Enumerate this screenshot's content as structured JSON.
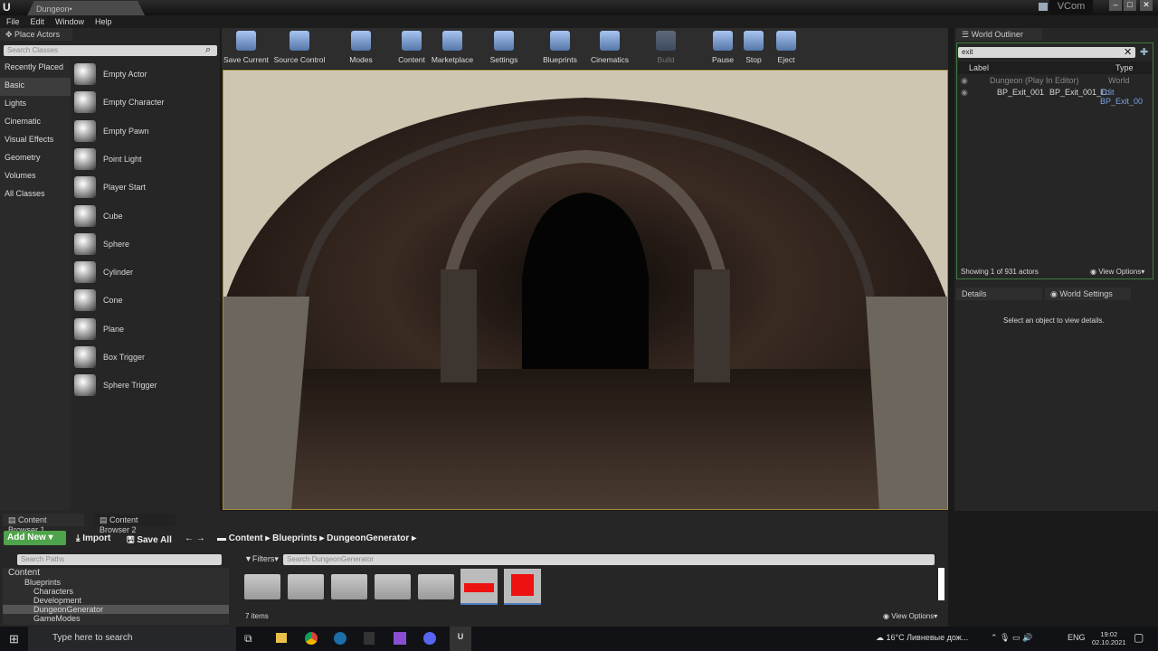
{
  "window": {
    "doc_tab": "Dungeon•",
    "user": "VCom",
    "logo": "U"
  },
  "menu": [
    "File",
    "Edit",
    "Window",
    "Help"
  ],
  "place_actors": {
    "tab": "Place Actors",
    "search_placeholder": "Search Classes",
    "categories": [
      "Recently Placed",
      "Basic",
      "Lights",
      "Cinematic",
      "Visual Effects",
      "Geometry",
      "Volumes",
      "All Classes"
    ],
    "selected_category": "Basic",
    "items": [
      "Empty Actor",
      "Empty Character",
      "Empty Pawn",
      "Point Light",
      "Player Start",
      "Cube",
      "Sphere",
      "Cylinder",
      "Cone",
      "Plane",
      "Box Trigger",
      "Sphere Trigger"
    ]
  },
  "toolbar": [
    "Save Current",
    "Source Control",
    "Modes",
    "Content",
    "Marketplace",
    "Settings",
    "Blueprints",
    "Cinematics",
    "Build",
    "Pause",
    "Stop",
    "Eject"
  ],
  "outliner": {
    "tab": "World Outliner",
    "search_value": "exit",
    "col_label": "Label",
    "col_type": "Type",
    "rows": [
      {
        "label": "Dungeon (Play In Editor)",
        "type": "World",
        "extra": ""
      },
      {
        "label": "BP_Exit_001",
        "type": "BP_Exit_001_C",
        "extra": "Edit BP_Exit_00"
      }
    ],
    "status": "Showing 1 of 931 actors",
    "view_options": "View Options"
  },
  "details": {
    "tab": "Details",
    "tab2": "World Settings",
    "empty": "Select an object to view details."
  },
  "content_browser": {
    "tabs": [
      "Content Browser 1",
      "Content Browser 2"
    ],
    "add_new": "Add New",
    "import": "Import",
    "save_all": "Save All",
    "breadcrumb": [
      "Content",
      "Blueprints",
      "DungeonGenerator"
    ],
    "search_paths_placeholder": "Search Paths",
    "tree": [
      "Content",
      "Blueprints",
      "Characters",
      "Development",
      "DungeonGenerator",
      "GameModes"
    ],
    "filters": "Filters",
    "search_placeholder": "Search DungeonGenerator",
    "count": "7 items",
    "view_options": "View Options"
  },
  "taskbar": {
    "search": "Type here to search",
    "weather": "16°C  Ливневые дож...",
    "lang": "ENG",
    "time": "19:02",
    "date": "02.10.2021"
  }
}
